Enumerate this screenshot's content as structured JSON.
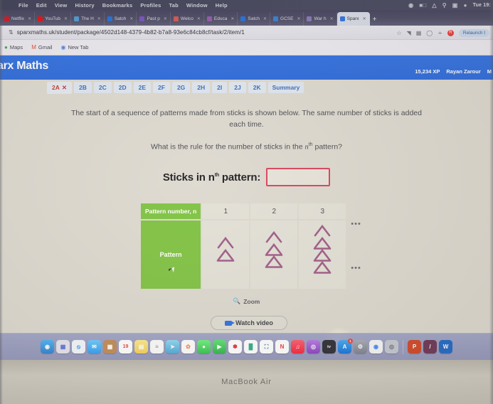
{
  "os": {
    "menubar": [
      "File",
      "Edit",
      "View",
      "History",
      "Bookmarks",
      "Profiles",
      "Tab",
      "Window",
      "Help"
    ],
    "status_icons": [
      "control-center-icon",
      "battery-icon",
      "wifi-icon",
      "search-icon",
      "screen-mirror-icon",
      "siri-icon"
    ],
    "clock": "Tue 19:",
    "device_label": "MacBook Air"
  },
  "browser": {
    "tabs": [
      {
        "title": "Netflix",
        "color": "#e50914"
      },
      {
        "title": "YouTub",
        "color": "#ff0000"
      },
      {
        "title": "The H",
        "color": "#4aa3df"
      },
      {
        "title": "Satch",
        "color": "#1a73e8"
      },
      {
        "title": "Past p",
        "color": "#7b4fc9"
      },
      {
        "title": "Welco",
        "color": "#e2574c"
      },
      {
        "title": "Educa",
        "color": "#9b59b6"
      },
      {
        "title": "Satch",
        "color": "#1a73e8"
      },
      {
        "title": "GCSE",
        "color": "#2e86de"
      },
      {
        "title": "War h",
        "color": "#8e7cc3"
      },
      {
        "title": "Sparx",
        "color": "#2f6fe0"
      }
    ],
    "active_tab_index": 10,
    "new_tab_label": "+",
    "close_label": "✕",
    "url": "sparxmaths.uk/student/package/4502d148-4379-4b82-b7a8-93e6c84cb8cf/task/2/item/1",
    "url_icon": "share-icon",
    "toolbar_icons": [
      "star-icon",
      "extension-icon",
      "reading-list-icon",
      "cast-icon",
      "translate-icon"
    ],
    "profile_badge": "R",
    "relaunch_label": "Relaunch t",
    "bookmarks": [
      {
        "label": "Maps",
        "icon": "maps-icon"
      },
      {
        "label": "Gmail",
        "icon": "gmail-icon"
      },
      {
        "label": "New Tab",
        "icon": "globe-icon"
      }
    ]
  },
  "app": {
    "brand": "arx Maths",
    "xp": "15,234 XP",
    "user": "Rayan Zarour",
    "menu_hint": "M",
    "question_tabs": [
      {
        "label": "2A",
        "state": "wrong",
        "mark": "✕"
      },
      {
        "label": "2B",
        "state": "default",
        "mark": ""
      },
      {
        "label": "2C",
        "state": "default",
        "mark": ""
      },
      {
        "label": "2D",
        "state": "default",
        "mark": ""
      },
      {
        "label": "2E",
        "state": "default",
        "mark": ""
      },
      {
        "label": "2F",
        "state": "default",
        "mark": ""
      },
      {
        "label": "2G",
        "state": "default",
        "mark": ""
      },
      {
        "label": "2H",
        "state": "default",
        "mark": ""
      },
      {
        "label": "2I",
        "state": "default",
        "mark": ""
      },
      {
        "label": "2J",
        "state": "default",
        "mark": ""
      },
      {
        "label": "2K",
        "state": "default",
        "mark": ""
      },
      {
        "label": "Summary",
        "state": "default",
        "mark": ""
      }
    ]
  },
  "question": {
    "paragraph1": "The start of a sequence of patterns made from sticks is shown below. The same number of sticks is added each time.",
    "paragraph2_pre": "What is the rule for the number of sticks in the ",
    "paragraph2_var": "n",
    "paragraph2_ord": "th",
    "paragraph2_post": " pattern?",
    "answer_label_pre": "Sticks in n",
    "answer_label_ord": "th",
    "answer_label_post": " pattern:",
    "answer_value": "",
    "answer_placeholder": ""
  },
  "pattern_table": {
    "row_header_1": "Pattern number, n",
    "row_header_2": "Pattern",
    "numbers": [
      "1",
      "2",
      "3"
    ],
    "ellipsis": "•••",
    "triangle_counts": [
      1,
      2,
      3
    ],
    "chevron_on_top": true,
    "header_color": "#7fc241",
    "cell_color": "#e3e0d6",
    "stick_color": "#a05a86"
  },
  "controls": {
    "zoom_label": "Zoom",
    "zoom_icon": "magnifier-icon",
    "watch_video_label": "Watch video",
    "watch_video_icon": "video-camera-icon"
  },
  "dock": {
    "apps": [
      {
        "name": "finder",
        "color": "#3c9de0",
        "glyph": "◉"
      },
      {
        "name": "launchpad",
        "color": "#dcdce4",
        "glyph": "☷"
      },
      {
        "name": "safari",
        "color": "#f2f7fb",
        "glyph": "⊕"
      },
      {
        "name": "mail",
        "color": "#46b0f5",
        "glyph": "✉"
      },
      {
        "name": "contacts",
        "color": "#c08a54",
        "glyph": "▤"
      },
      {
        "name": "calendar",
        "color": "#ffffff",
        "glyph": "19"
      },
      {
        "name": "notes",
        "color": "#f7d96b",
        "glyph": "▤"
      },
      {
        "name": "reminders",
        "color": "#fbfbfb",
        "glyph": "≡"
      },
      {
        "name": "maps",
        "color": "#6ec07a",
        "glyph": "➤"
      },
      {
        "name": "photos",
        "color": "#fcfcfc",
        "glyph": "✿"
      },
      {
        "name": "messages",
        "color": "#4cd964",
        "glyph": "●"
      },
      {
        "name": "facetime",
        "color": "#35c759",
        "glyph": "▶"
      },
      {
        "name": "freeform",
        "color": "#ffffff",
        "glyph": "╱"
      },
      {
        "name": "numbers",
        "color": "#ffffff",
        "glyph": "█"
      },
      {
        "name": "keynote",
        "color": "#ffffff",
        "glyph": "⬚"
      },
      {
        "name": "news",
        "color": "#ffffff",
        "glyph": "N"
      },
      {
        "name": "music",
        "color": "#fa3c4c",
        "glyph": "♫"
      },
      {
        "name": "podcasts",
        "color": "#9b59d0",
        "glyph": "◎"
      },
      {
        "name": "appletv",
        "color": "#2b2b32",
        "glyph": "tv"
      },
      {
        "name": "appstore",
        "color": "#1e8ce8",
        "glyph": "A",
        "badge": "1"
      },
      {
        "name": "system-settings",
        "color": "#8e8e99",
        "glyph": "⚙"
      },
      {
        "name": "chrome",
        "color": "#f5f5f5",
        "glyph": "◉"
      },
      {
        "name": "preview",
        "color": "#b9bcc4",
        "glyph": "◎"
      },
      {
        "name": "powerpoint",
        "color": "#d04423",
        "glyph": "P"
      },
      {
        "name": "onenote",
        "color": "#6b3352",
        "glyph": "/"
      },
      {
        "name": "word",
        "color": "#1e66c4",
        "glyph": "W"
      }
    ]
  }
}
